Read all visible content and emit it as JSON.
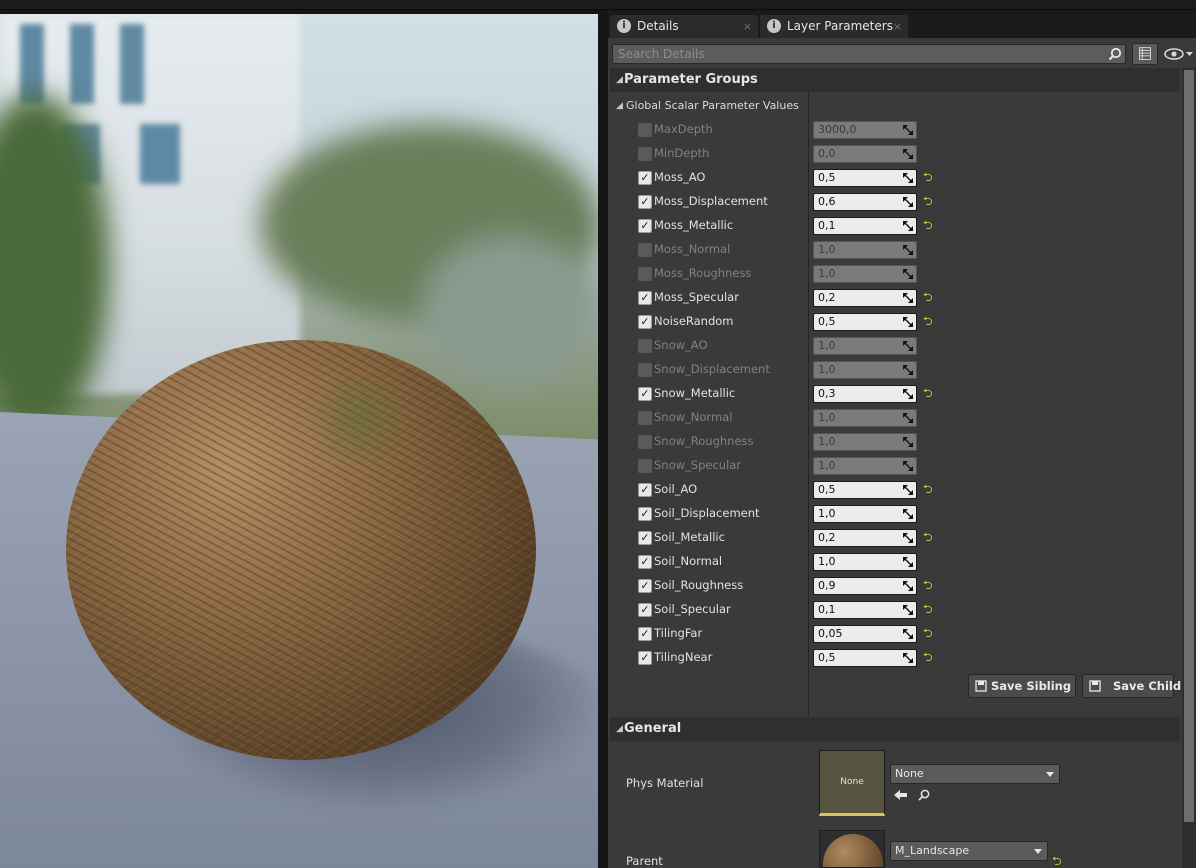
{
  "tabs": [
    {
      "label": "Details",
      "close": "×"
    },
    {
      "label": "Layer Parameters",
      "close": "×"
    }
  ],
  "search": {
    "placeholder": "Search Details"
  },
  "sections": {
    "parameter_groups": "Parameter Groups",
    "global_scalar": "Global Scalar Parameter Values",
    "general": "General"
  },
  "params": [
    {
      "name": "MaxDepth",
      "value": "3000,0",
      "enabled": false,
      "reset": false
    },
    {
      "name": "MinDepth",
      "value": "0,0",
      "enabled": false,
      "reset": false
    },
    {
      "name": "Moss_AO",
      "value": "0,5",
      "enabled": true,
      "reset": true
    },
    {
      "name": "Moss_Displacement",
      "value": "0,6",
      "enabled": true,
      "reset": true
    },
    {
      "name": "Moss_Metallic",
      "value": "0,1",
      "enabled": true,
      "reset": true
    },
    {
      "name": "Moss_Normal",
      "value": "1,0",
      "enabled": false,
      "reset": false
    },
    {
      "name": "Moss_Roughness",
      "value": "1,0",
      "enabled": false,
      "reset": false
    },
    {
      "name": "Moss_Specular",
      "value": "0,2",
      "enabled": true,
      "reset": true
    },
    {
      "name": "NoiseRandom",
      "value": "0,5",
      "enabled": true,
      "reset": true
    },
    {
      "name": "Snow_AO",
      "value": "1,0",
      "enabled": false,
      "reset": false
    },
    {
      "name": "Snow_Displacement",
      "value": "1,0",
      "enabled": false,
      "reset": false
    },
    {
      "name": "Snow_Metallic",
      "value": "0,3",
      "enabled": true,
      "reset": true
    },
    {
      "name": "Snow_Normal",
      "value": "1,0",
      "enabled": false,
      "reset": false
    },
    {
      "name": "Snow_Roughness",
      "value": "1,0",
      "enabled": false,
      "reset": false
    },
    {
      "name": "Snow_Specular",
      "value": "1,0",
      "enabled": false,
      "reset": false
    },
    {
      "name": "Soil_AO",
      "value": "0,5",
      "enabled": true,
      "reset": true
    },
    {
      "name": "Soil_Displacement",
      "value": "1,0",
      "enabled": true,
      "reset": false
    },
    {
      "name": "Soil_Metallic",
      "value": "0,2",
      "enabled": true,
      "reset": true
    },
    {
      "name": "Soil_Normal",
      "value": "1,0",
      "enabled": true,
      "reset": false
    },
    {
      "name": "Soil_Roughness",
      "value": "0,9",
      "enabled": true,
      "reset": true
    },
    {
      "name": "Soil_Specular",
      "value": "0,1",
      "enabled": true,
      "reset": true
    },
    {
      "name": "TilingFar",
      "value": "0,05",
      "enabled": true,
      "reset": true
    },
    {
      "name": "TilingNear",
      "value": "0,5",
      "enabled": true,
      "reset": true
    }
  ],
  "buttons": {
    "save_sibling": "Save Sibling",
    "save_child": "Save Child"
  },
  "general": {
    "phys_material": {
      "label": "Phys Material",
      "thumb": "None",
      "value": "None"
    },
    "parent": {
      "label": "Parent",
      "value": "M_Landscape"
    }
  },
  "colors": {
    "reset_arrow": "#d8c23a",
    "panel_bg": "#3a3a3a"
  }
}
